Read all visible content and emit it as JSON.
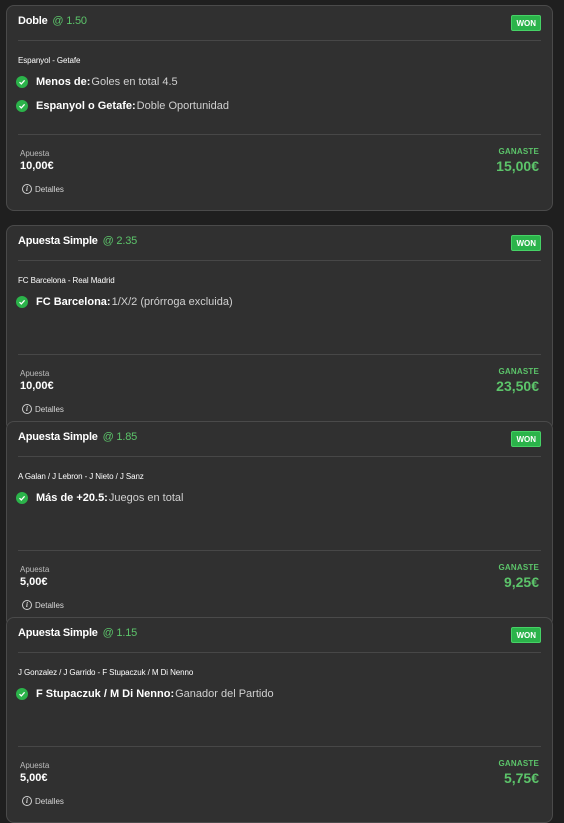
{
  "bets": [
    {
      "type": "Doble",
      "odds": "@ 1.50",
      "status": "WON",
      "event": "Espanyol - Getafe",
      "selections": [
        {
          "name": "Menos de:",
          "market": "Goles en total 4.5"
        },
        {
          "name": "Espanyol o Getafe:",
          "market": "Doble Oportunidad"
        }
      ],
      "stake_label": "Apuesta",
      "stake": "10,00€",
      "win_label": "GANASTE",
      "win": "15,00€",
      "details": "Detalles"
    },
    {
      "type": "Apuesta Simple",
      "odds": "@ 2.35",
      "status": "WON",
      "event": "FC Barcelona - Real Madrid",
      "selections": [
        {
          "name": "FC Barcelona:",
          "market": "1/X/2 (prórroga excluida)"
        }
      ],
      "stake_label": "Apuesta",
      "stake": "10,00€",
      "win_label": "GANASTE",
      "win": "23,50€",
      "details": "Detalles"
    },
    {
      "type": "Apuesta Simple",
      "odds": "@ 1.85",
      "status": "WON",
      "event": "A Galan / J Lebron - J Nieto / J Sanz",
      "selections": [
        {
          "name": "Más de +20.5:",
          "market": "Juegos en total"
        }
      ],
      "stake_label": "Apuesta",
      "stake": "5,00€",
      "win_label": "GANASTE",
      "win": "9,25€",
      "details": "Detalles"
    },
    {
      "type": "Apuesta Simple",
      "odds": "@ 1.15",
      "status": "WON",
      "event": "J Gonzalez / J Garrido - F Stupaczuk / M Di Nenno",
      "selections": [
        {
          "name": "F Stupaczuk / M Di Nenno:",
          "market": "Ganador del Partido"
        }
      ],
      "stake_label": "Apuesta",
      "stake": "5,00€",
      "win_label": "GANASTE",
      "win": "5,75€",
      "details": "Detalles"
    }
  ]
}
